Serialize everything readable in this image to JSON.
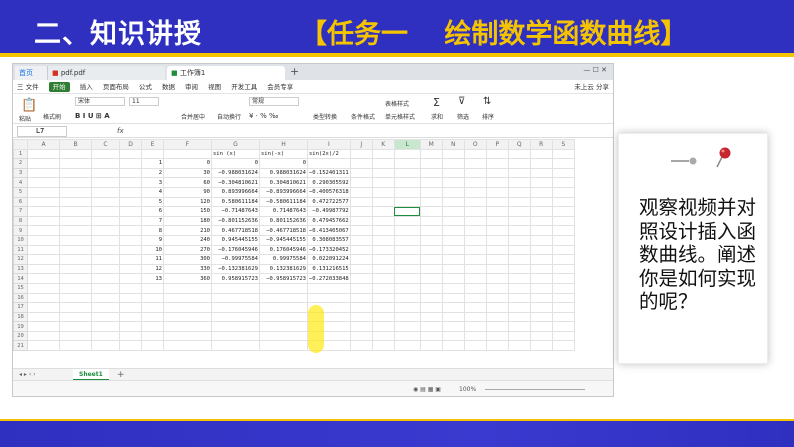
{
  "slide": {
    "title": "二、知识讲授",
    "task": "【任务一　 绘制数学函数曲线】",
    "card_text": "观察视频并对照设计插入函数曲线。阐述你是如何实现的呢？",
    "colors": {
      "header": "#2f2fc0",
      "accent": "#f5c400",
      "highlight": "#ffe600",
      "sheet_green": "#1e8e3e"
    }
  },
  "spreadsheet": {
    "tabs": {
      "home": "首页",
      "pdf": "pdf.pdf",
      "book": "工作簿1"
    },
    "menu": [
      "三 文件",
      "开始",
      "插入",
      "页面布局",
      "公式",
      "数据",
      "审阅",
      "视图",
      "开发工具",
      "会员专享"
    ],
    "menu_right": "未上云  分享",
    "ribbon": {
      "format_painter": "格式刷",
      "paste": "粘贴",
      "font": "宋体",
      "size": "11",
      "merge": "合并居中",
      "wrap": "自动换行",
      "number_format": "常规",
      "type_convert": "类型转换",
      "cond_format": "条件格式",
      "table_style": "表格样式",
      "cell_style": "单元格样式",
      "sum": "求和",
      "filter": "筛选",
      "sort": "排序"
    },
    "name_box": "L7",
    "fx": "fx",
    "columns": [
      "A",
      "B",
      "C",
      "D",
      "E",
      "F",
      "G",
      "H",
      "I",
      "J",
      "K",
      "L",
      "M",
      "N",
      "O",
      "P",
      "Q",
      "R",
      "S"
    ],
    "selected_column": "L",
    "headers": {
      "F": "sin (x)",
      "G": "sin(-x)",
      "H": "sin(2x)/2"
    },
    "data": [
      {
        "e": "1",
        "f": "0",
        "g": "0",
        "h": "0"
      },
      {
        "e": "2",
        "f": "30",
        "g": "−0.988031624",
        "h": "0.988031624",
        "i": "−0.152401311"
      },
      {
        "e": "3",
        "f": "60",
        "g": "−0.304810621",
        "h": "0.304810621",
        "i": "0.290305592"
      },
      {
        "e": "4",
        "f": "90",
        "g": "0.893996664",
        "h": "−0.893996664",
        "i": "−0.400576318"
      },
      {
        "e": "5",
        "f": "120",
        "g": "0.580611184",
        "h": "−0.580611184",
        "i": "0.472722577"
      },
      {
        "e": "6",
        "f": "150",
        "g": "−0.71487643",
        "h": "0.71487643",
        "i": "−0.49987792"
      },
      {
        "e": "7",
        "f": "180",
        "g": "−0.801152636",
        "h": "0.801152636",
        "i": "0.479457662"
      },
      {
        "e": "8",
        "f": "210",
        "g": "0.467718518",
        "h": "−0.467718518",
        "i": "−0.413405067"
      },
      {
        "e": "9",
        "f": "240",
        "g": "0.945445155",
        "h": "−0.945445155",
        "i": "0.308083557"
      },
      {
        "e": "10",
        "f": "270",
        "g": "−0.176045946",
        "h": "0.176045946",
        "i": "−0.173320452"
      },
      {
        "e": "11",
        "f": "300",
        "g": "−0.99975584",
        "h": "0.99975584",
        "i": "0.022091224"
      },
      {
        "e": "12",
        "f": "330",
        "g": "−0.132381629",
        "h": "0.132381629",
        "i": "0.131216515"
      },
      {
        "e": "13",
        "f": "360",
        "g": "0.958915723",
        "h": "−0.958915723",
        "i": "−0.272033848"
      }
    ],
    "sheet_tab": "Sheet1",
    "zoom": "100%"
  }
}
